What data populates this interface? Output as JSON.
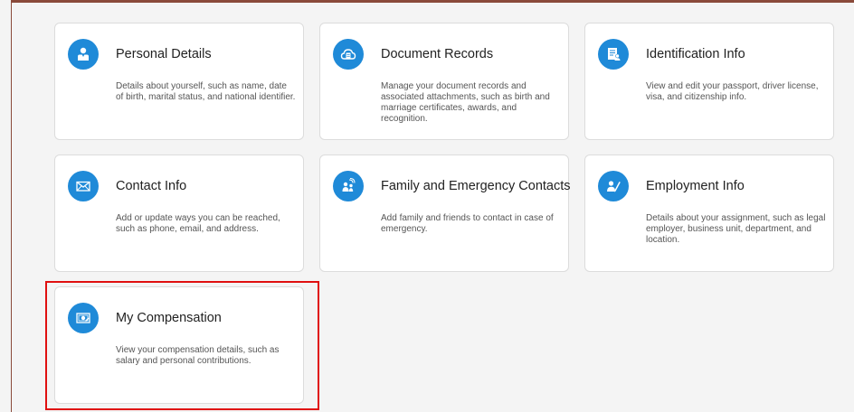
{
  "tiles": [
    {
      "title": "Personal Details",
      "description": "Details about yourself, such as name, date of birth, marital status, and national identifier.",
      "icon": "person-icon"
    },
    {
      "title": "Document Records",
      "description": "Manage your document records and associated attachments, such as birth and marriage certificates, awards, and recognition.",
      "icon": "cloud-document-icon"
    },
    {
      "title": "Identification Info",
      "description": "View and edit your passport, driver license, visa, and citizenship info.",
      "icon": "id-card-icon"
    },
    {
      "title": "Contact Info",
      "description": "Add or update ways you can be reached, such as phone, email, and address.",
      "icon": "envelope-icon"
    },
    {
      "title": "Family and Emergency Contacts",
      "description": "Add family and friends to contact in case of emergency.",
      "icon": "family-icon"
    },
    {
      "title": "Employment Info",
      "description": "Details about your assignment, such as legal employer, business unit, department, and location.",
      "icon": "person-check-icon"
    },
    {
      "title": "My Compensation",
      "description": "View your compensation details, such as salary and personal contributions.",
      "icon": "money-icon"
    }
  ],
  "colors": {
    "icon_background": "#1f8ad8",
    "highlight_border": "#e01010",
    "page_background": "#f4f4f4"
  }
}
